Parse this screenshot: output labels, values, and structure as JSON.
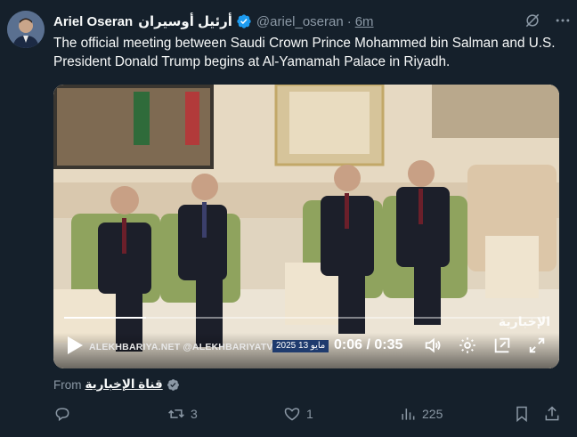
{
  "author": {
    "name": "Ariel Oseran",
    "arabic_name": "أرئيل أوسيران",
    "handle": "@ariel_oseran",
    "time": "6m"
  },
  "tweet": {
    "text": "The official meeting between Saudi Crown Prince Mohammed bin Salman and U.S. President Donald Trump begins at Al-Yamamah Palace in Riyadh."
  },
  "video": {
    "current_time": "0:06",
    "separator": "/",
    "duration": "0:35",
    "progress": 0.17,
    "watermark_left": "ALEKHBARIYA.NET  @ALEKHBARIYATV",
    "watermark_date": "2025  مايو  13",
    "channel_logo": "الإخبارية"
  },
  "source": {
    "label": "From",
    "name": "قناة الإخبارية"
  },
  "actions": {
    "replies": "",
    "retweets": "3",
    "likes": "1",
    "views": "225"
  },
  "colors": {
    "background": "#15202b",
    "text": "#f7f9f9",
    "secondary": "#8b98a5",
    "verified": "#1d9bf0"
  }
}
